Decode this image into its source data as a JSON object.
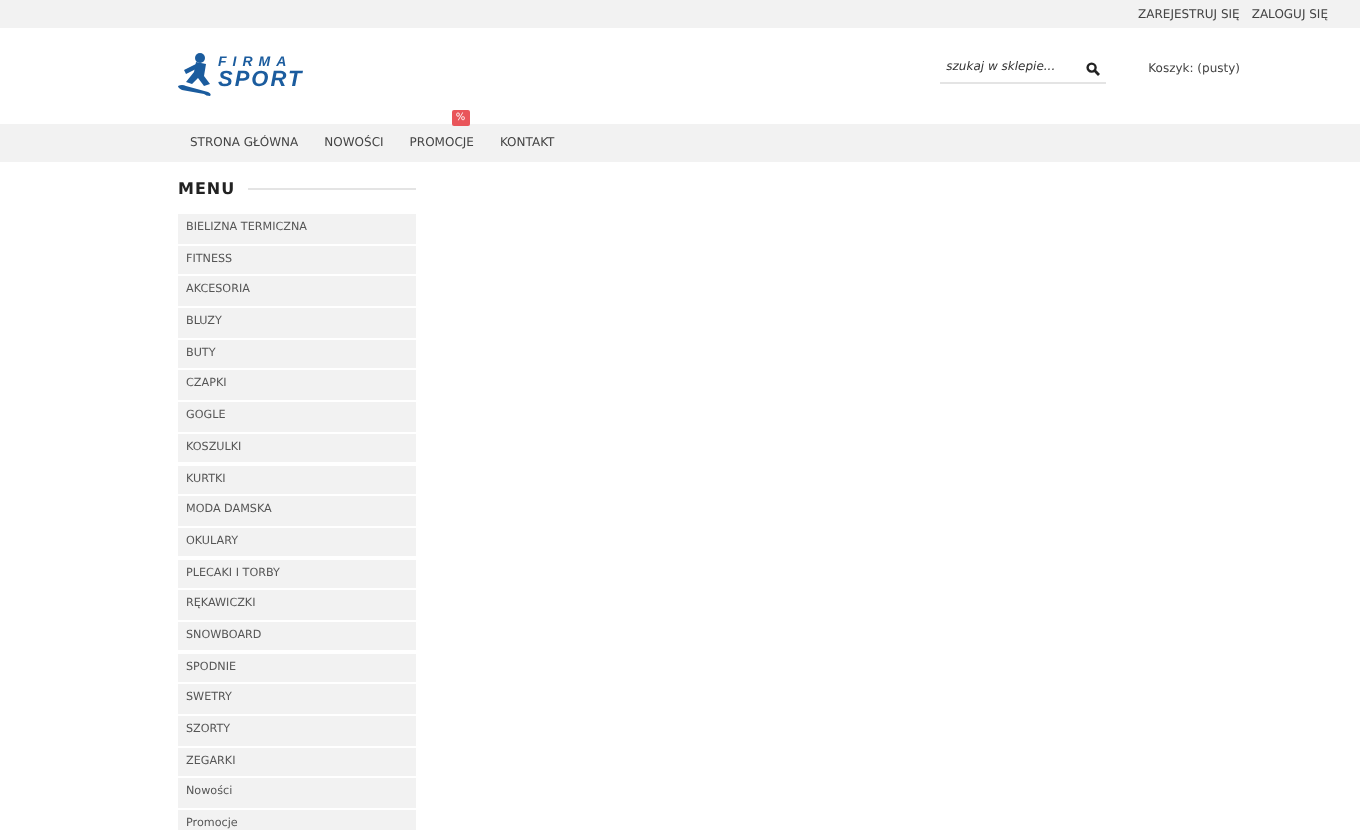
{
  "top_links": [
    "ZAREJESTRUJ SIĘ",
    "ZALOGUJ SIĘ"
  ],
  "logo": {
    "line_1": "FIRMA",
    "line_2": "SPORT"
  },
  "search": {
    "placeholder": "szukaj w sklepie..."
  },
  "cart": "Koszyk: (pusty)",
  "nav": [
    {
      "label": "STRONA GŁÓWNA"
    },
    {
      "label": "NOWOŚCI"
    },
    {
      "label": "PROMOCJE",
      "badge": "%"
    },
    {
      "label": "KONTAKT"
    }
  ],
  "menu": {
    "title": "MENU",
    "items": [
      "BIELIZNA TERMICZNA",
      "FITNESS",
      "AKCESORIA",
      "BLUZY",
      "BUTY",
      "CZAPKI",
      "GOGLE",
      "KOSZULKI",
      "KURTKI",
      "MODA DAMSKA",
      "OKULARY",
      "PLECAKI I TORBY",
      "RĘKAWICZKI",
      "SNOWBOARD",
      "SPODNIE",
      "SWETRY",
      "SZORTY",
      "ZEGARKI",
      "Nowości",
      "Promocje"
    ]
  }
}
